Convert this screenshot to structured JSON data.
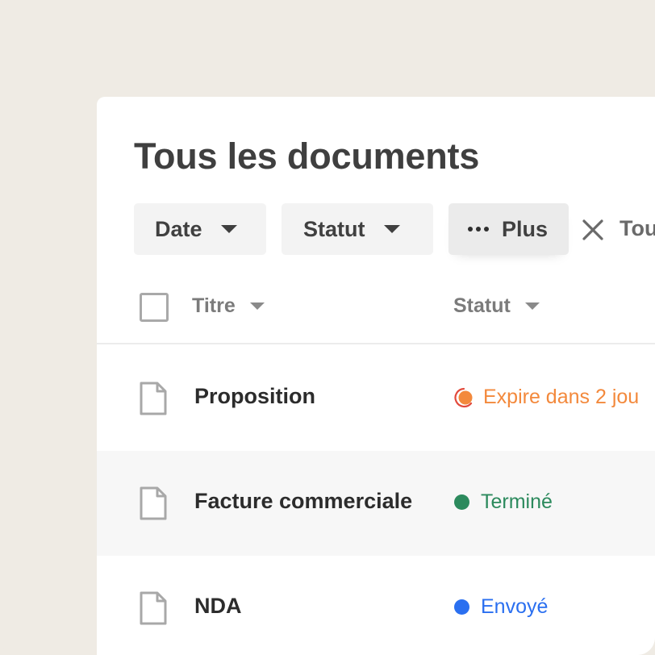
{
  "page": {
    "title": "Tous les documents"
  },
  "filters": {
    "date_label": "Date",
    "statut_label": "Statut",
    "plus_label": "Plus",
    "clear_label": "Tou"
  },
  "table": {
    "columns": [
      {
        "label": "Titre"
      },
      {
        "label": "Statut"
      }
    ],
    "rows": [
      {
        "title": "Proposition",
        "status": "Expire dans 2 jou",
        "status_color": "#f3893c"
      },
      {
        "title": "Facture commerciale",
        "status": "Terminé",
        "status_color": "#2c8a5d"
      },
      {
        "title": "NDA",
        "status": "Envoyé",
        "status_color": "#2a6ff0"
      }
    ]
  },
  "icons": {
    "filter_caret": "chevron-down-icon",
    "more": "more-dots-icon",
    "clear": "close-icon",
    "document": "document-icon",
    "checkbox": "checkbox-icon"
  },
  "colors": {
    "background": "#efebe4",
    "panel": "#ffffff",
    "expire": "#f3893c",
    "expire_ring": "#e24a3c",
    "done": "#2c8a5d",
    "sent": "#2a6ff0"
  }
}
